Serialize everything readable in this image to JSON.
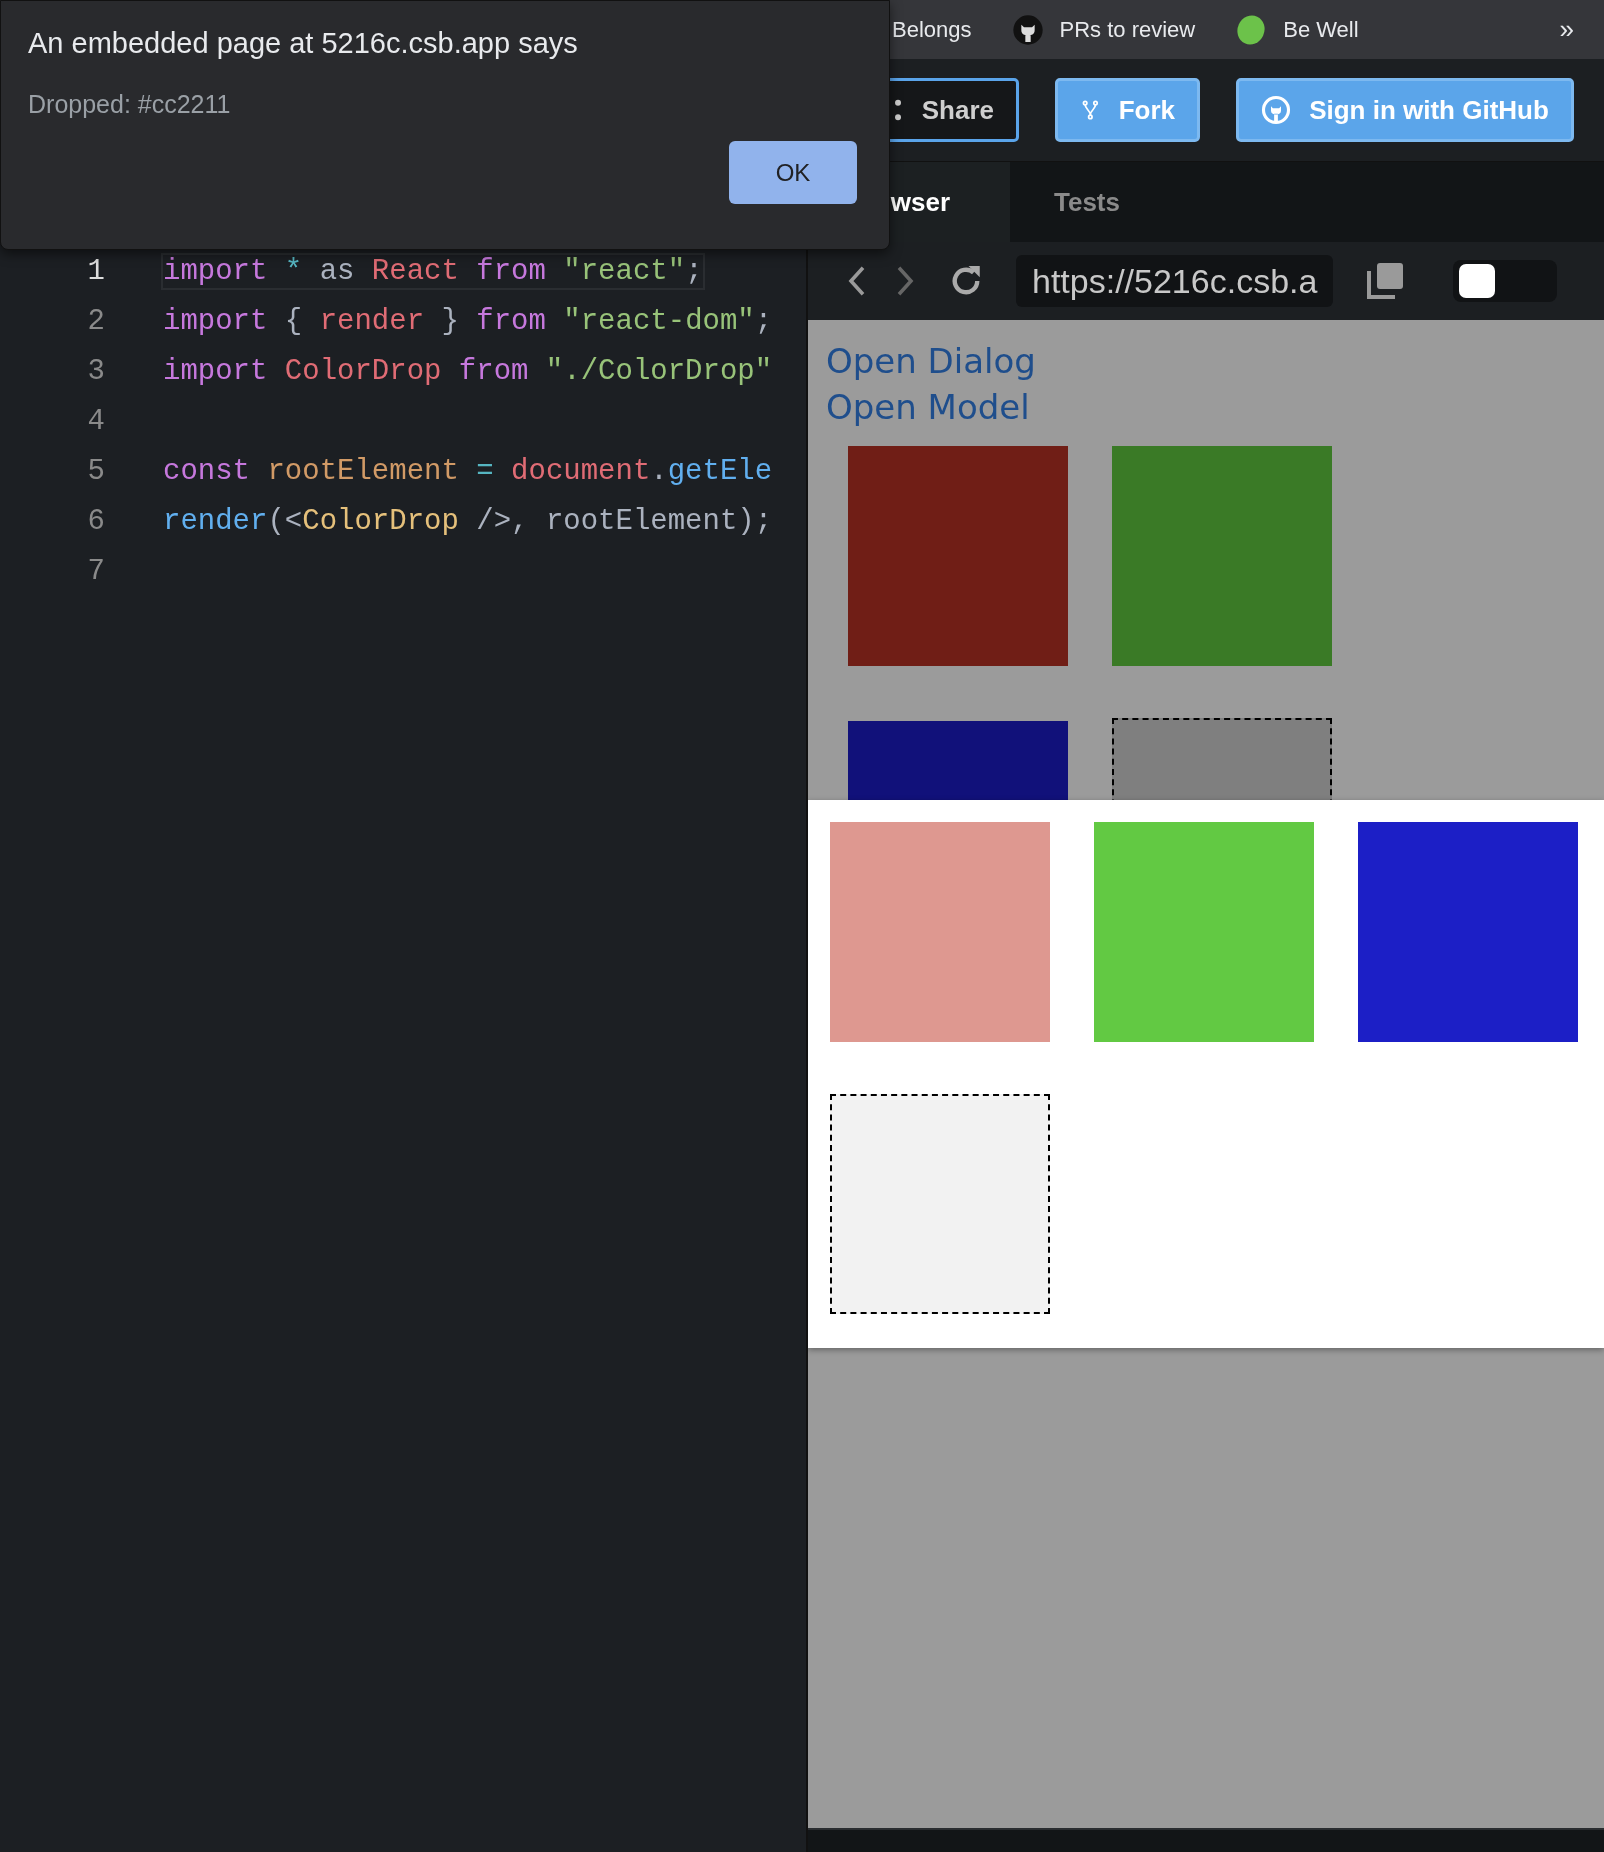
{
  "dialog": {
    "title": "An embedded page at 5216c.csb.app says",
    "message": "Dropped: #cc2211",
    "ok_label": "OK"
  },
  "bookmarks": [
    {
      "label": "Belongs",
      "kind": "plain"
    },
    {
      "label": "PRs to review",
      "kind": "github"
    },
    {
      "label": "Be Well",
      "kind": "lime"
    }
  ],
  "bookmarks_more": "»",
  "header_buttons": [
    {
      "label": "Share",
      "kind": "share"
    },
    {
      "label": "Fork",
      "kind": "fork"
    },
    {
      "label": "Sign in with GitHub",
      "kind": "github"
    }
  ],
  "preview_tabs": [
    {
      "label": "wser",
      "selected": true
    },
    {
      "label": "Tests",
      "selected": false
    }
  ],
  "address_bar": {
    "value": "https://5216c.csb.a",
    "toggle_on": false
  },
  "editor": {
    "lines": [
      {
        "number": "1",
        "current": true,
        "tokens": [
          {
            "text": "import",
            "kind": "keyword"
          },
          {
            "text": " *",
            "kind": "operator"
          },
          {
            "text": " as ",
            "kind": "plain"
          },
          {
            "text": "React",
            "kind": "variable"
          },
          {
            "text": " from",
            "kind": "keyword"
          },
          {
            "text": " \"react\"",
            "kind": "string"
          },
          {
            "text": ";",
            "kind": "plain"
          }
        ]
      },
      {
        "number": "2",
        "current": false,
        "tokens": [
          {
            "text": "import",
            "kind": "keyword"
          },
          {
            "text": " { ",
            "kind": "plain"
          },
          {
            "text": "render",
            "kind": "variable"
          },
          {
            "text": " } ",
            "kind": "plain"
          },
          {
            "text": "from",
            "kind": "keyword"
          },
          {
            "text": " \"react-dom\"",
            "kind": "string"
          },
          {
            "text": ";",
            "kind": "plain"
          }
        ]
      },
      {
        "number": "3",
        "current": false,
        "tokens": [
          {
            "text": "import",
            "kind": "keyword"
          },
          {
            "text": " ColorDrop",
            "kind": "variable"
          },
          {
            "text": " from",
            "kind": "keyword"
          },
          {
            "text": " \"./ColorDrop\"",
            "kind": "string"
          }
        ]
      },
      {
        "number": "4",
        "current": false
      },
      {
        "number": "5",
        "current": false,
        "tokens": [
          {
            "text": "const",
            "kind": "keyword"
          },
          {
            "text": " rootElement",
            "kind": "constant"
          },
          {
            "text": " =",
            "kind": "operator"
          },
          {
            "text": " document",
            "kind": "variable"
          },
          {
            "text": ".",
            "kind": "plain"
          },
          {
            "text": "getEle",
            "kind": "function"
          }
        ]
      },
      {
        "number": "6",
        "current": false,
        "tokens": [
          {
            "text": "render",
            "kind": "function"
          },
          {
            "text": "(<",
            "kind": "plain"
          },
          {
            "text": "ColorDrop",
            "kind": "tag"
          },
          {
            "text": " />, rootElement);",
            "kind": "plain"
          }
        ]
      },
      {
        "number": "7",
        "current": false
      }
    ]
  },
  "preview": {
    "links": [
      "Open Dialog",
      "Open Model"
    ],
    "swatches": [
      {
        "kind": "color",
        "color": "#701e16"
      },
      {
        "kind": "color",
        "color": "#3a7a26"
      },
      {
        "kind": "color",
        "color": "#11117a"
      },
      {
        "kind": "dropzone"
      }
    ],
    "modal": {
      "swatches": [
        {
          "kind": "color",
          "color": "#de9890"
        },
        {
          "kind": "color",
          "color": "#62c943"
        },
        {
          "kind": "color",
          "color": "#1c1fc6"
        },
        {
          "kind": "dropzone"
        }
      ]
    }
  }
}
